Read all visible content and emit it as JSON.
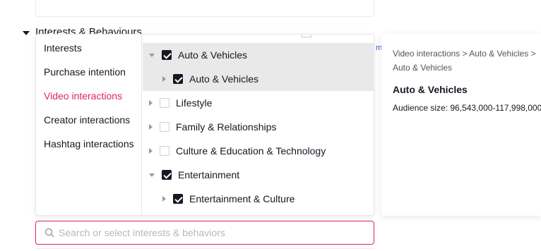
{
  "section": {
    "title": "Interests & Behaviours"
  },
  "stray_link": "m",
  "categories": [
    {
      "label": "Interests",
      "active": false
    },
    {
      "label": "Purchase intention",
      "active": false
    },
    {
      "label": "Video interactions",
      "active": true
    },
    {
      "label": "Creator interactions",
      "active": false
    },
    {
      "label": "Hashtag interactions",
      "active": false
    }
  ],
  "tree": [
    {
      "label": "Auto & Vehicles",
      "level": 0,
      "expanded": true,
      "checked": true,
      "highlighted": true
    },
    {
      "label": "Auto & Vehicles",
      "level": 1,
      "expanded": false,
      "checked": true,
      "highlighted": true
    },
    {
      "label": "Lifestyle",
      "level": 0,
      "expanded": false,
      "checked": false,
      "highlighted": false
    },
    {
      "label": "Family & Relationships",
      "level": 0,
      "expanded": false,
      "checked": false,
      "highlighted": false
    },
    {
      "label": "Culture & Education & Technology",
      "level": 0,
      "expanded": false,
      "checked": false,
      "highlighted": false
    },
    {
      "label": "Entertainment",
      "level": 0,
      "expanded": true,
      "checked": true,
      "highlighted": false
    },
    {
      "label": "Entertainment & Culture",
      "level": 1,
      "expanded": false,
      "checked": true,
      "highlighted": false
    }
  ],
  "search": {
    "placeholder": "Search or select interests & behaviors",
    "value": ""
  },
  "info": {
    "breadcrumb": "Video interactions > Auto & Vehicles > Auto & Vehicles",
    "title": "Auto & Vehicles",
    "audience": "Audience size: 96,543,000-117,998,000"
  },
  "colors": {
    "accent": "#e0245e",
    "checkbox_checked": "#161823",
    "highlight_row": "#e9e9e9"
  },
  "icons": {
    "search": "search-icon",
    "expand": "caret-down-icon",
    "collapse": "caret-right-icon"
  }
}
